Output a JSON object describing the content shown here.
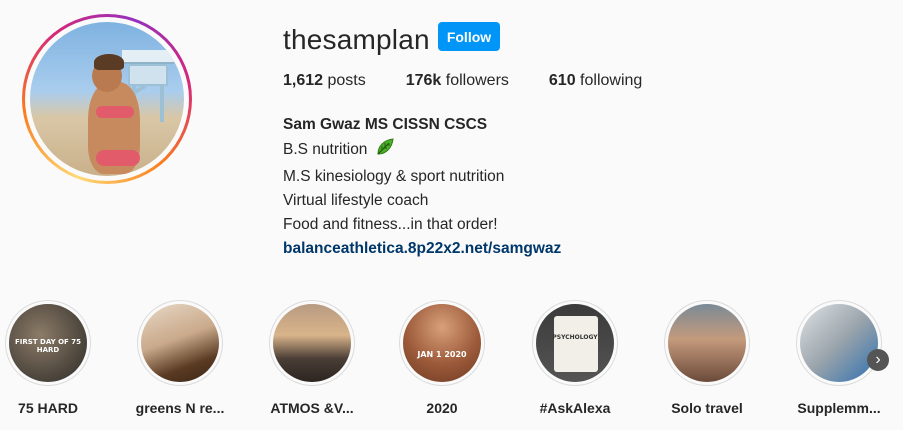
{
  "profile": {
    "username": "thesamplan",
    "follow_label": "Follow",
    "stats": {
      "posts_count": "1,612",
      "posts_label": " posts",
      "followers_count": "176k",
      "followers_label": " followers",
      "following_count": "610",
      "following_label": " following"
    },
    "bio": {
      "name": "Sam Gwaz MS CISSN CSCS",
      "line1": "B.S nutrition ",
      "line2": "M.S kinesiology & sport nutrition",
      "line3": "Virtual lifestyle coach",
      "line4": "Food and fitness...in that order!",
      "link": "balanceathletica.8p22x2.net/samgwaz"
    }
  },
  "highlights": [
    {
      "label": "75 HARD",
      "caption": "FIRST DAY OF 75 HARD"
    },
    {
      "label": "greens N re...",
      "caption": ""
    },
    {
      "label": "ATMOS &V...",
      "caption": ""
    },
    {
      "label": "2020",
      "caption": "JAN 1 2020"
    },
    {
      "label": "#AskAlexa",
      "caption": "PSYCHOLOGY"
    },
    {
      "label": "Solo travel",
      "caption": ""
    },
    {
      "label": "Supplemm...",
      "caption": ""
    }
  ],
  "colors": {
    "accent": "#0095f6",
    "link": "#00376b",
    "text": "#262626"
  },
  "icons": [
    "leaf-icon",
    "chevron-right-icon"
  ]
}
